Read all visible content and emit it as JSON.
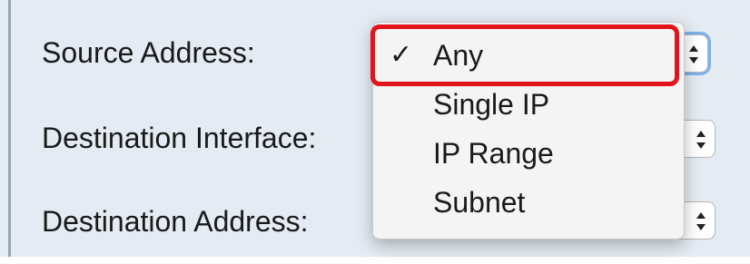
{
  "form": {
    "source_address_label": "Source Address:",
    "destination_interface_label": "Destination Interface:",
    "destination_address_label": "Destination Address:"
  },
  "dropdown": {
    "selected": "Any",
    "check_glyph": "✓",
    "options": [
      "Any",
      "Single IP",
      "IP Range",
      "Subnet"
    ]
  },
  "colors": {
    "highlight_border": "#e2131a",
    "focus_ring": "#7fb2ec",
    "panel_background": "#e4ebf2"
  }
}
